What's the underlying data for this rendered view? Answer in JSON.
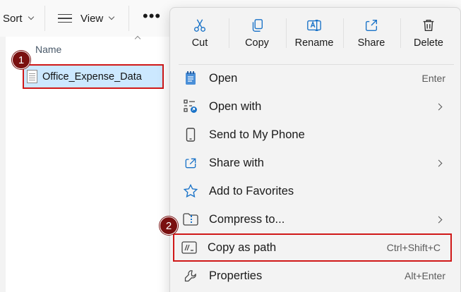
{
  "toolbar": {
    "sort_label": "Sort",
    "view_label": "View",
    "more_label": "•••"
  },
  "file_list": {
    "column_name": "Name",
    "selected_file": "Office_Expense_Data"
  },
  "callouts": [
    "1",
    "2"
  ],
  "context_menu": {
    "actions": [
      {
        "label": "Cut",
        "icon": "scissors-icon"
      },
      {
        "label": "Copy",
        "icon": "copy-icon"
      },
      {
        "label": "Rename",
        "icon": "rename-icon"
      },
      {
        "label": "Share",
        "icon": "share-icon"
      },
      {
        "label": "Delete",
        "icon": "trash-icon"
      }
    ],
    "items": [
      {
        "label": "Open",
        "shortcut": "Enter",
        "icon": "notepad-icon"
      },
      {
        "label": "Open with",
        "shortcut": "",
        "icon": "open-with-icon",
        "submenu": true
      },
      {
        "label": "Send to My Phone",
        "shortcut": "",
        "icon": "phone-icon"
      },
      {
        "label": "Share with",
        "shortcut": "",
        "icon": "share-with-icon",
        "submenu": true
      },
      {
        "label": "Add to Favorites",
        "shortcut": "",
        "icon": "star-icon"
      },
      {
        "label": "Compress to...",
        "shortcut": "",
        "icon": "zip-folder-icon",
        "submenu": true
      },
      {
        "label": "Copy as path",
        "shortcut": "Ctrl+Shift+C",
        "icon": "copy-path-icon",
        "highlighted": true
      },
      {
        "label": "Properties",
        "shortcut": "Alt+Enter",
        "icon": "wrench-icon"
      }
    ]
  },
  "colors": {
    "accent": "#1a73c8",
    "highlight_outline": "#d01818",
    "badge_fill": "#7a1010",
    "selection": "#cce8ff"
  }
}
